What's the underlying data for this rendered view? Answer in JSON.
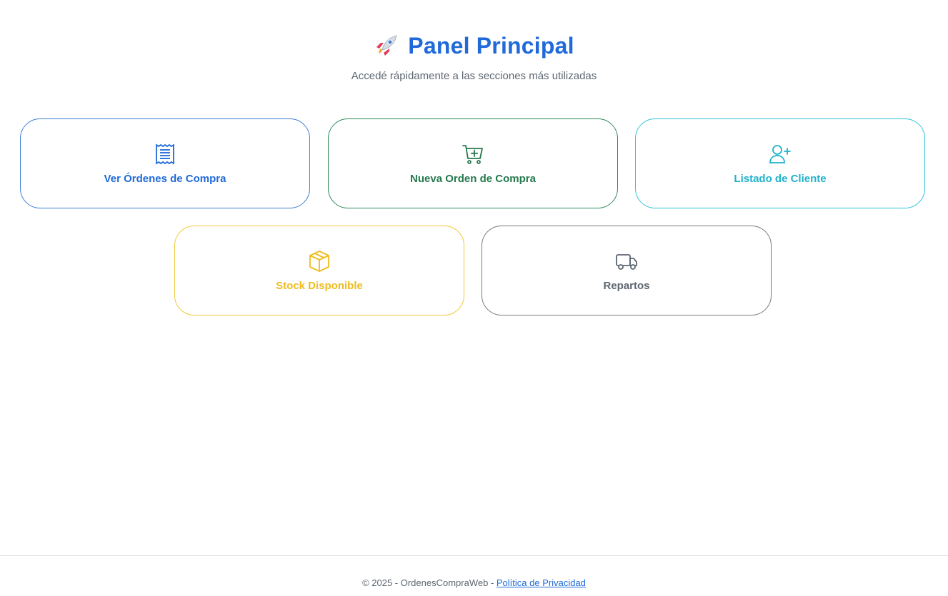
{
  "header": {
    "title": "Panel Principal",
    "subtitle": "Accedé rápidamente a las secciones más utilizadas",
    "icon": "rocket-icon"
  },
  "cards": [
    {
      "label": "Ver Órdenes de Compra",
      "icon": "receipt-icon",
      "color": "#1f6ad8"
    },
    {
      "label": "Nueva Orden de Compra",
      "icon": "cart-plus-icon",
      "color": "#24794c"
    },
    {
      "label": "Listado de Cliente",
      "icon": "person-add-icon",
      "color": "#1fb3cc"
    },
    {
      "label": "Stock Disponible",
      "icon": "box-icon",
      "color": "#efbb1f"
    },
    {
      "label": "Repartos",
      "icon": "truck-icon",
      "color": "#5d6670"
    }
  ],
  "footer": {
    "copyright": "© 2025 - OrdenesCompraWeb - ",
    "privacy_link": "Política de Privacidad"
  }
}
